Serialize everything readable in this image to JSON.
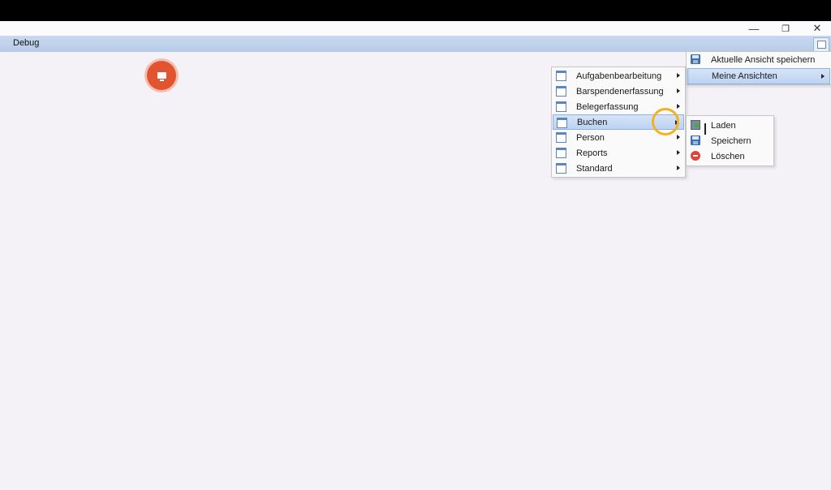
{
  "window": {
    "controls": {
      "minimize": "—",
      "restore": "❐",
      "close": "✕"
    }
  },
  "menubar": {
    "debug_label": "Debug"
  },
  "views_menu": {
    "items": [
      {
        "label": "Aktuelle Ansicht speichern",
        "icon": "save-icon"
      },
      {
        "label": "Meine Ansichten",
        "icon": "",
        "submenu": true,
        "highlighted": true
      }
    ]
  },
  "my_views_menu": {
    "items": [
      {
        "label": "Aufgabenbearbeitung"
      },
      {
        "label": "Barspendenerfassung"
      },
      {
        "label": "Belegerfassung"
      },
      {
        "label": "Buchen",
        "highlighted": true
      },
      {
        "label": "Person"
      },
      {
        "label": "Reports"
      },
      {
        "label": "Standard"
      }
    ]
  },
  "buchen_menu": {
    "items": [
      {
        "label": "Laden",
        "icon": "load-icon"
      },
      {
        "label": "Speichern",
        "icon": "save-icon"
      },
      {
        "label": "Löschen",
        "icon": "delete-icon"
      }
    ]
  },
  "colors": {
    "accent": "#bcd3f1",
    "record": "#e2532f",
    "cursor_ring": "#f2b21e"
  }
}
